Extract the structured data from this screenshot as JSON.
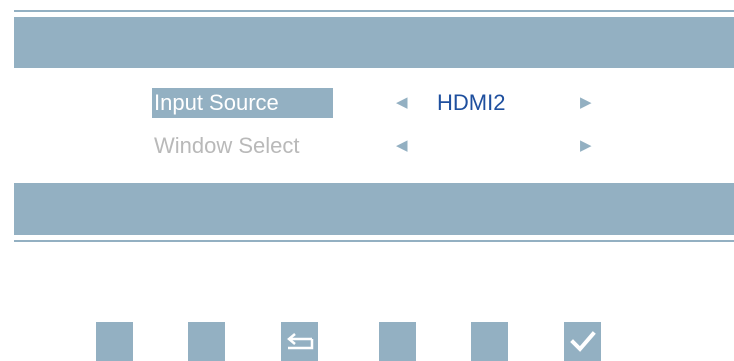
{
  "menu": {
    "items": [
      {
        "label": "Input Source",
        "value": "HDMI2",
        "selected": true
      },
      {
        "label": "Window Select",
        "value": "",
        "selected": false
      }
    ],
    "arrows": {
      "left": "◀",
      "right": "▶"
    }
  },
  "keys": [
    {
      "icon": "blank-key"
    },
    {
      "icon": "blank-key"
    },
    {
      "icon": "back-return-icon"
    },
    {
      "icon": "blank-key"
    },
    {
      "icon": "blank-key"
    },
    {
      "icon": "checkmark-icon"
    }
  ],
  "colors": {
    "accent": "#93b0c2",
    "value_text": "#1e4f9e",
    "disabled_text": "#b9b9b9",
    "background": "#ffffff"
  }
}
